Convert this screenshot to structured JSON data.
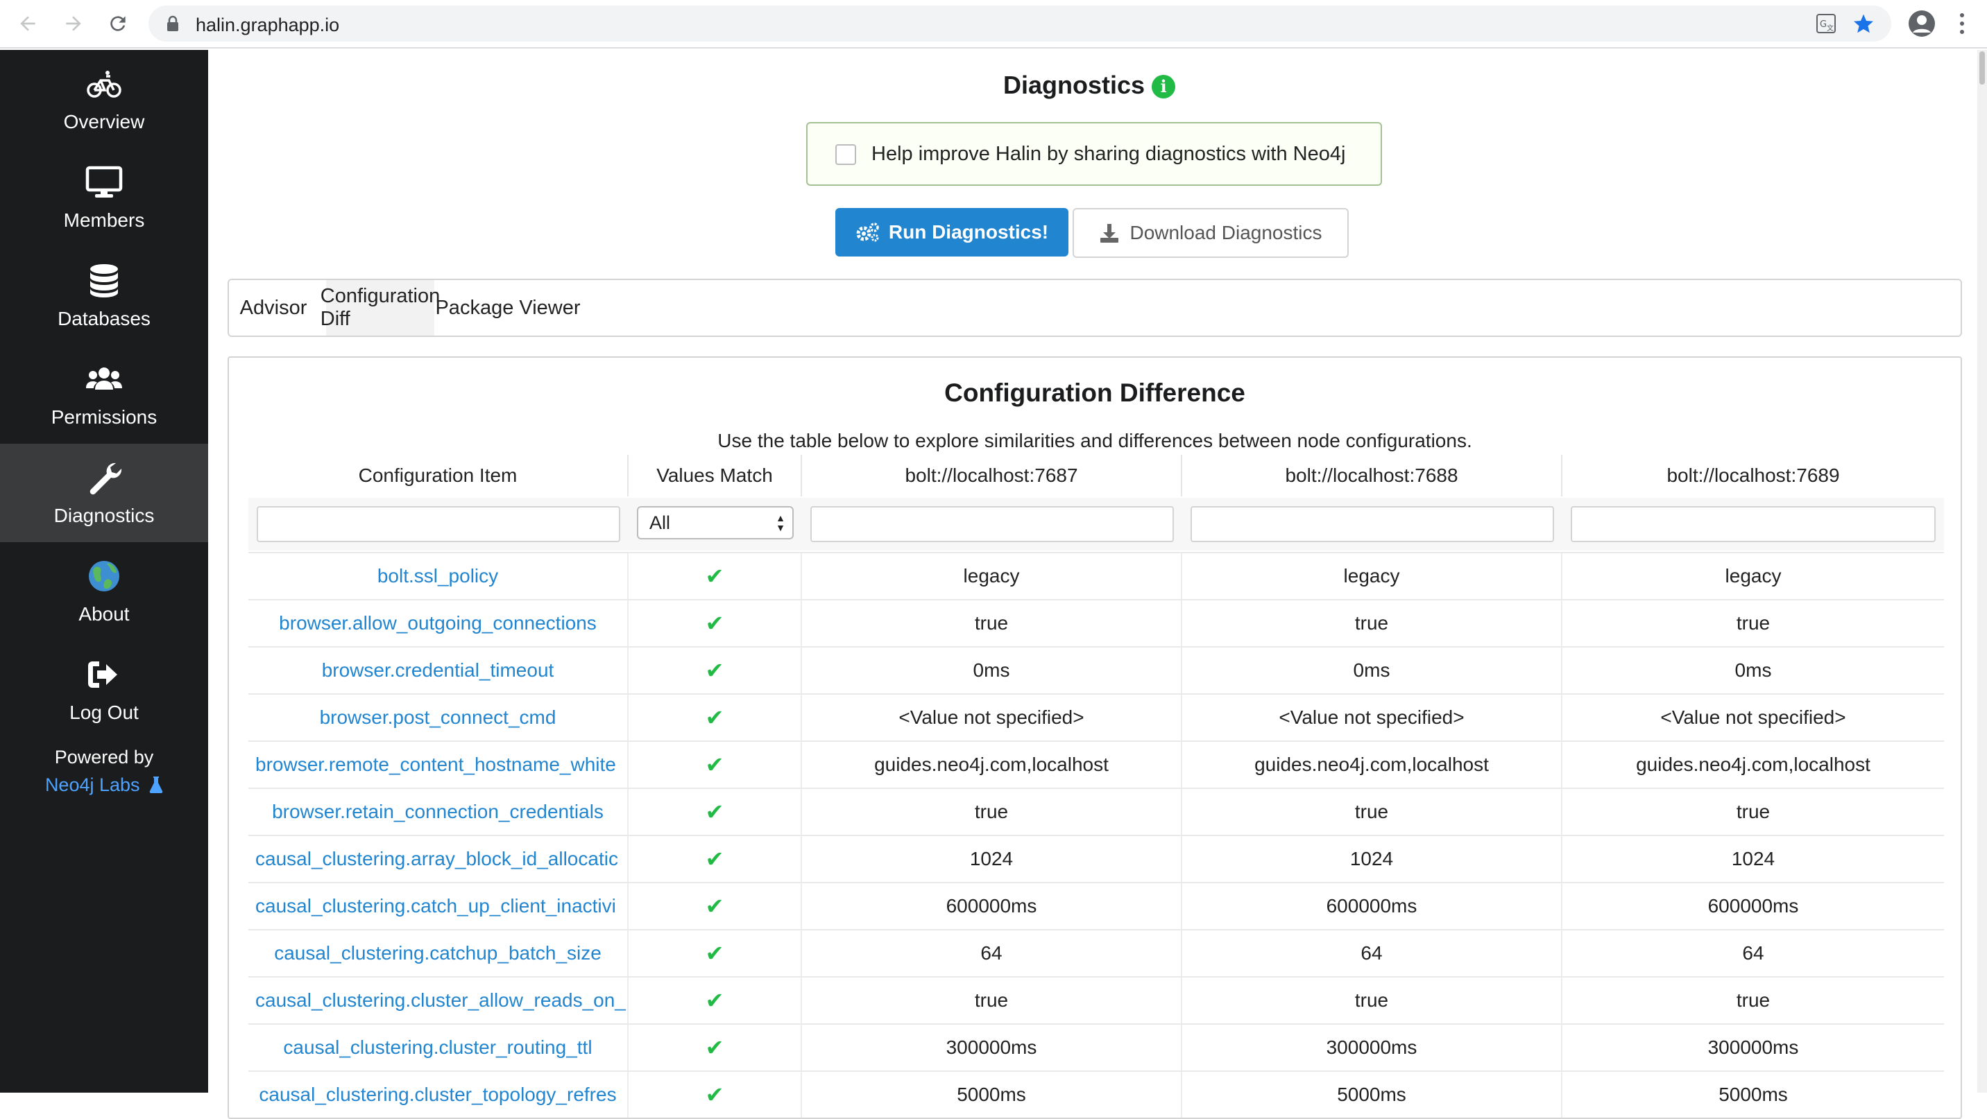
{
  "browser": {
    "url": "halin.graphapp.io"
  },
  "sidebar": {
    "items": [
      {
        "label": "Overview",
        "icon": "bicycle-icon",
        "active": false
      },
      {
        "label": "Members",
        "icon": "desktop-icon",
        "active": false
      },
      {
        "label": "Databases",
        "icon": "database-icon",
        "active": false
      },
      {
        "label": "Permissions",
        "icon": "users-icon",
        "active": false
      },
      {
        "label": "Diagnostics",
        "icon": "wrench-icon",
        "active": true
      },
      {
        "label": "About",
        "icon": "globe-icon",
        "active": false
      },
      {
        "label": "Log Out",
        "icon": "sign-out-icon",
        "active": false
      }
    ],
    "powered_by": "Powered by",
    "powered_link": "Neo4j Labs"
  },
  "main": {
    "title": "Diagnostics",
    "share_label": "Help improve Halin by sharing diagnostics with Neo4j",
    "run_button": "Run Diagnostics!",
    "download_button": "Download Diagnostics",
    "tabs": [
      {
        "label": "Advisor",
        "active": false
      },
      {
        "label": "Configuration Diff",
        "active": true
      },
      {
        "label": "Package Viewer",
        "active": false
      }
    ],
    "panel": {
      "title": "Configuration Difference",
      "subtitle": "Use the table below to explore similarities and differences between node configurations.",
      "columns": [
        "Configuration Item",
        "Values Match",
        "bolt://localhost:7687",
        "bolt://localhost:7688",
        "bolt://localhost:7689"
      ],
      "filter_select": "All",
      "rows": [
        {
          "key": "bolt.ssl_policy",
          "match": "✔",
          "v1": "legacy",
          "v2": "legacy",
          "v3": "legacy"
        },
        {
          "key": "browser.allow_outgoing_connections",
          "match": "✔",
          "v1": "true",
          "v2": "true",
          "v3": "true"
        },
        {
          "key": "browser.credential_timeout",
          "match": "✔",
          "v1": "0ms",
          "v2": "0ms",
          "v3": "0ms"
        },
        {
          "key": "browser.post_connect_cmd",
          "match": "✔",
          "v1": "<Value not specified>",
          "v2": "<Value not specified>",
          "v3": "<Value not specified>"
        },
        {
          "key": "browser.remote_content_hostname_white",
          "match": "✔",
          "v1": "guides.neo4j.com,localhost",
          "v2": "guides.neo4j.com,localhost",
          "v3": "guides.neo4j.com,localhost"
        },
        {
          "key": "browser.retain_connection_credentials",
          "match": "✔",
          "v1": "true",
          "v2": "true",
          "v3": "true"
        },
        {
          "key": "causal_clustering.array_block_id_allocatic",
          "match": "✔",
          "v1": "1024",
          "v2": "1024",
          "v3": "1024"
        },
        {
          "key": "causal_clustering.catch_up_client_inactivi",
          "match": "✔",
          "v1": "600000ms",
          "v2": "600000ms",
          "v3": "600000ms"
        },
        {
          "key": "causal_clustering.catchup_batch_size",
          "match": "✔",
          "v1": "64",
          "v2": "64",
          "v3": "64"
        },
        {
          "key": "causal_clustering.cluster_allow_reads_on_",
          "match": "✔",
          "v1": "true",
          "v2": "true",
          "v3": "true"
        },
        {
          "key": "causal_clustering.cluster_routing_ttl",
          "match": "✔",
          "v1": "300000ms",
          "v2": "300000ms",
          "v3": "300000ms"
        },
        {
          "key": "causal_clustering.cluster_topology_refres",
          "match": "✔",
          "v1": "5000ms",
          "v2": "5000ms",
          "v3": "5000ms"
        }
      ]
    }
  }
}
